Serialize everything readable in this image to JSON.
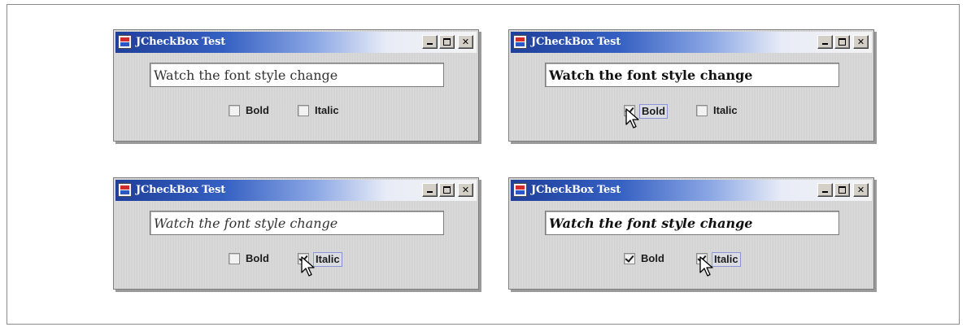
{
  "windows": [
    {
      "title": "JCheckBox Test",
      "text": "Watch the font style change",
      "bold": false,
      "italic": false,
      "bold_label": "Bold",
      "italic_label": "Italic"
    },
    {
      "title": "JCheckBox Test",
      "text": "Watch the font style change",
      "bold": true,
      "italic": false,
      "bold_label": "Bold",
      "italic_label": "Italic"
    },
    {
      "title": "JCheckBox Test",
      "text": "Watch the font style change",
      "bold": false,
      "italic": true,
      "bold_label": "Bold",
      "italic_label": "Italic"
    },
    {
      "title": "JCheckBox Test",
      "text": "Watch the font style change",
      "bold": true,
      "italic": true,
      "bold_label": "Bold",
      "italic_label": "Italic"
    }
  ],
  "window_controls": {
    "close_glyph": "✕"
  },
  "icons": {
    "app": "java-cup-icon",
    "cursor": "arrow-pointer-icon"
  }
}
